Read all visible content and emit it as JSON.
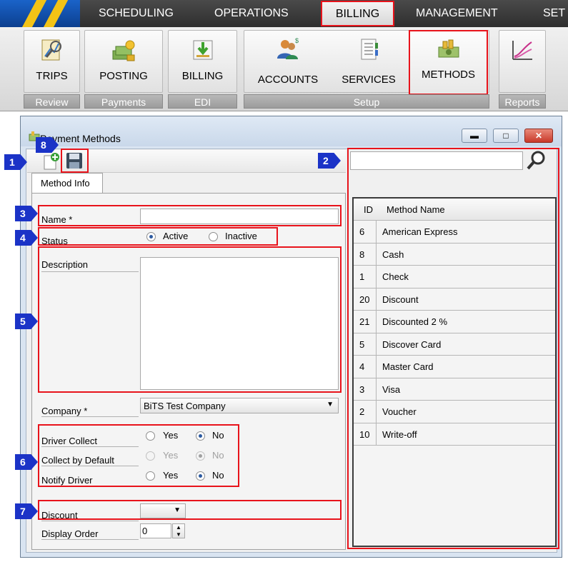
{
  "nav": {
    "tabs": [
      "SCHEDULING",
      "OPERATIONS",
      "BILLING",
      "MANAGEMENT",
      "SET"
    ]
  },
  "ribbon": {
    "buttons": [
      "TRIPS",
      "POSTING",
      "BILLING",
      "ACCOUNTS",
      "SERVICES",
      "METHODS"
    ],
    "groups": [
      "Review",
      "Payments",
      "EDI",
      "Setup",
      "Reports"
    ]
  },
  "window": {
    "title": "Payment Methods"
  },
  "markers": [
    "1",
    "2",
    "3",
    "4",
    "5",
    "6",
    "7",
    "8"
  ],
  "form": {
    "tab_label": "Method Info",
    "name_label": "Name *",
    "name_value": "",
    "status_label": "Status",
    "status_active": "Active",
    "status_inactive": "Inactive",
    "description_label": "Description",
    "description_value": "",
    "company_label": "Company *",
    "company_value": "BiTS Test Company",
    "driver_collect_label": "Driver Collect",
    "collect_default_label": "Collect by Default",
    "notify_driver_label": "Notify Driver",
    "yes": "Yes",
    "no": "No",
    "discount_label": "Discount",
    "discount_value": "",
    "display_order_label": "Display Order",
    "display_order_value": "0"
  },
  "search": {
    "value": ""
  },
  "grid": {
    "headers": [
      "ID",
      "Method Name"
    ],
    "rows": [
      {
        "id": "6",
        "name": "American Express"
      },
      {
        "id": "8",
        "name": "Cash"
      },
      {
        "id": "1",
        "name": "Check"
      },
      {
        "id": "20",
        "name": "Discount"
      },
      {
        "id": "21",
        "name": "Discounted 2 %"
      },
      {
        "id": "5",
        "name": "Discover Card"
      },
      {
        "id": "4",
        "name": "Master Card"
      },
      {
        "id": "3",
        "name": "Visa"
      },
      {
        "id": "2",
        "name": "Voucher"
      },
      {
        "id": "10",
        "name": "Write-off"
      }
    ]
  },
  "colors": {
    "highlight": "#e8131b",
    "marker": "#1b33c7",
    "nav_bg": "#3a3a3a",
    "accent_blue": "#1a63c9"
  }
}
